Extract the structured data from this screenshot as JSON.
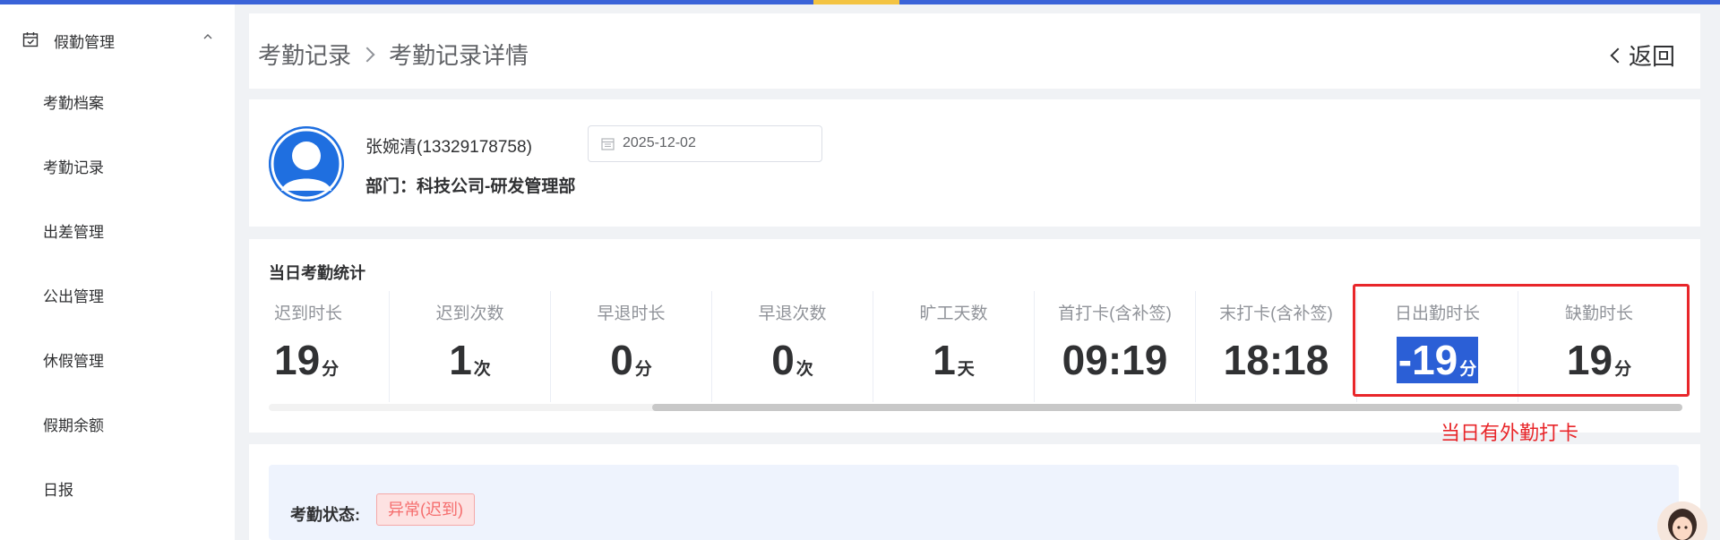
{
  "sidebar": {
    "group_label": "假勤管理",
    "items": [
      {
        "label": "考勤档案"
      },
      {
        "label": "考勤记录"
      },
      {
        "label": "出差管理"
      },
      {
        "label": "公出管理"
      },
      {
        "label": "休假管理"
      },
      {
        "label": "假期余额"
      },
      {
        "label": "日报"
      }
    ]
  },
  "header": {
    "breadcrumb": [
      "考勤记录",
      "考勤记录详情"
    ],
    "back_label": "返回"
  },
  "user": {
    "name": "张婉清(13329178758)",
    "department": "部门：科技公司-研发管理部",
    "date": "2025-12-02"
  },
  "stats": {
    "title": "当日考勤统计",
    "items": [
      {
        "label": "迟到时长",
        "value": "19",
        "unit": "分"
      },
      {
        "label": "迟到次数",
        "value": "1",
        "unit": "次"
      },
      {
        "label": "早退时长",
        "value": "0",
        "unit": "分"
      },
      {
        "label": "早退次数",
        "value": "0",
        "unit": "次"
      },
      {
        "label": "旷工天数",
        "value": "1",
        "unit": "天"
      },
      {
        "label": "首打卡(含补签)",
        "value": "09:19",
        "unit": ""
      },
      {
        "label": "末打卡(含补签)",
        "value": "18:18",
        "unit": ""
      },
      {
        "label": "日出勤时长",
        "value": "-19",
        "unit": "分"
      },
      {
        "label": "缺勤时长",
        "value": "19",
        "unit": "分"
      }
    ]
  },
  "annotation": "当日有外勤打卡",
  "status": {
    "label": "考勤状态:",
    "badge": "异常(迟到)"
  },
  "colors": {
    "primary": "#3a63d8",
    "accent": "#f3c342",
    "annotation_red": "#e8262a",
    "badge_red": "#f56c6c"
  }
}
